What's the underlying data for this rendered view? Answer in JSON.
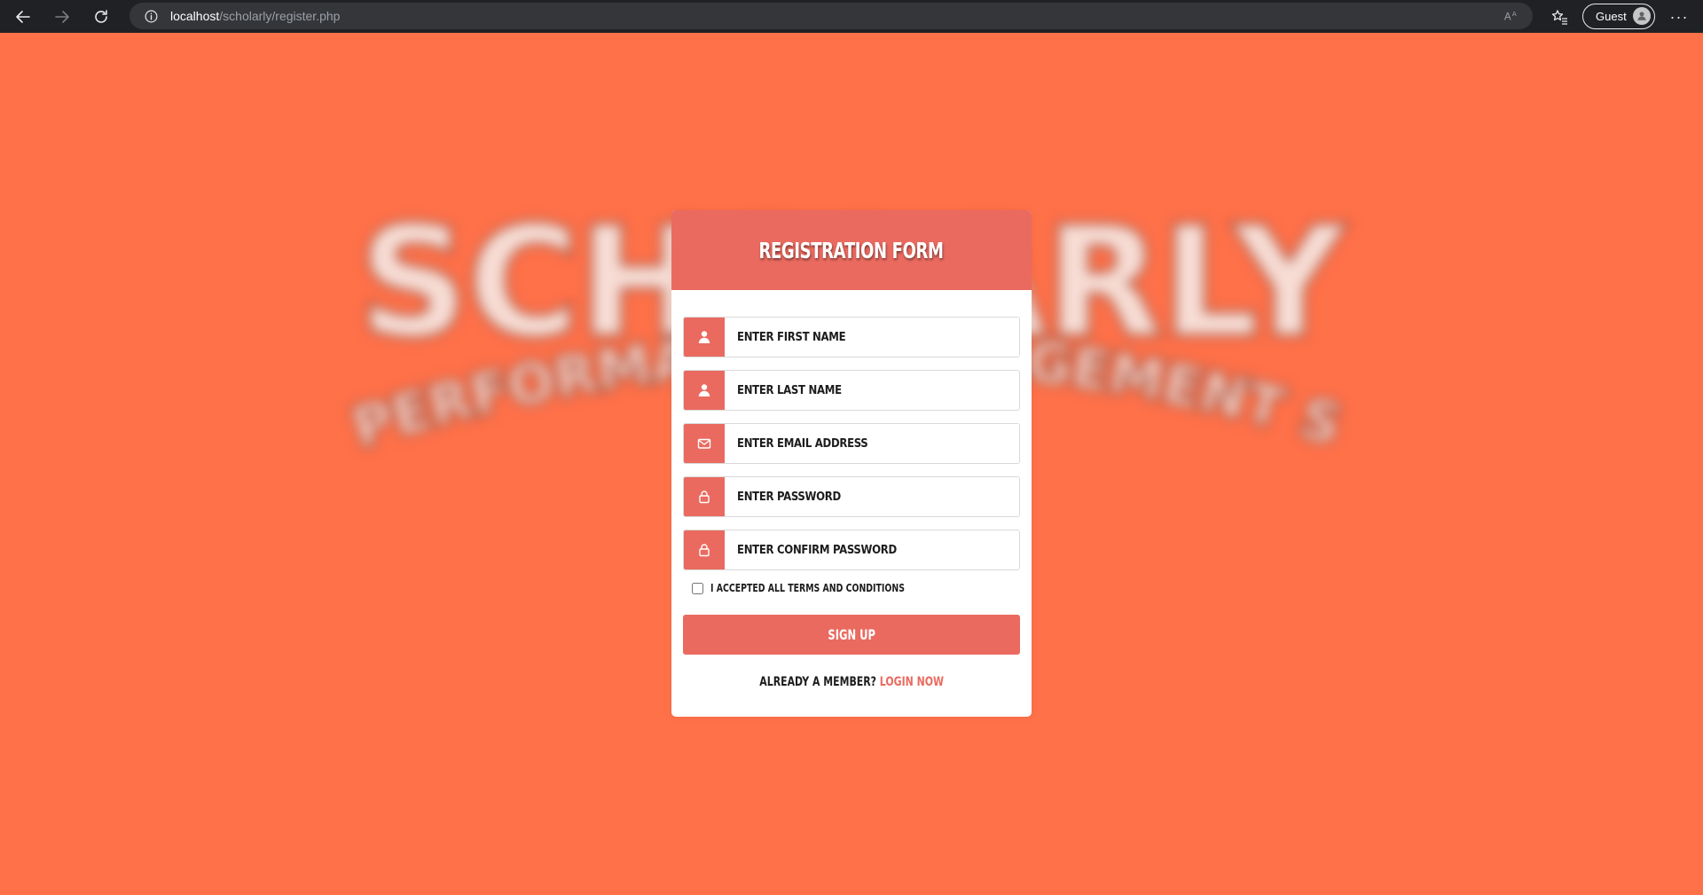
{
  "browser": {
    "url_host": "localhost",
    "url_path": "/scholarly/register.php",
    "profile_label": "Guest",
    "icons": {
      "back": "arrow-left-icon",
      "forward": "arrow-right-icon",
      "reload": "reload-icon",
      "site_info": "info-icon",
      "read_aloud": "read-aloud-icon",
      "favorites": "favorites-icon",
      "more": "more-icon"
    }
  },
  "background": {
    "logo_text": "SCHOLARLY",
    "logo_subtitle": "PUPIL PERFORMANCE MANAGEMENT SYSTEM",
    "color": "#ff7149"
  },
  "form": {
    "title": "REGISTRATION FORM",
    "accent_color": "#ea6a5f",
    "fields": [
      {
        "placeholder": "ENTER FIRST NAME",
        "icon": "user-icon"
      },
      {
        "placeholder": "ENTER LAST NAME",
        "icon": "user-icon"
      },
      {
        "placeholder": "ENTER EMAIL ADDRESS",
        "icon": "mail-icon"
      },
      {
        "placeholder": "ENTER PASSWORD",
        "icon": "lock-icon"
      },
      {
        "placeholder": "ENTER CONFIRM PASSWORD",
        "icon": "lock-icon"
      }
    ],
    "terms_label": "I ACCEPTED ALL TERMS AND CONDITIONS",
    "terms_checked": false,
    "submit_label": "SIGN UP",
    "footer_text": "ALREADY A MEMBER?",
    "login_link": "LOGIN NOW"
  }
}
